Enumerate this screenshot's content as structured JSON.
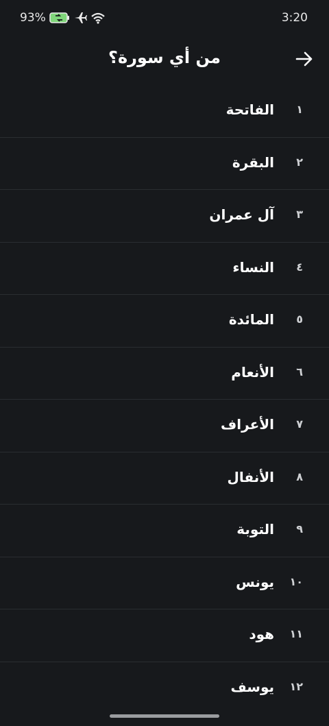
{
  "status_bar": {
    "battery_percent": "93%",
    "time": "3:20",
    "icons": [
      "battery-charging-icon",
      "airplane-icon",
      "wifi-icon"
    ]
  },
  "header": {
    "title": "من أي سورة؟",
    "back_icon": "arrow-right-icon"
  },
  "surahs": [
    {
      "number": "١",
      "name": "الفاتحة"
    },
    {
      "number": "٢",
      "name": "البقرة"
    },
    {
      "number": "٣",
      "name": "آل عمران"
    },
    {
      "number": "٤",
      "name": "النساء"
    },
    {
      "number": "٥",
      "name": "المائدة"
    },
    {
      "number": "٦",
      "name": "الأنعام"
    },
    {
      "number": "٧",
      "name": "الأعراف"
    },
    {
      "number": "٨",
      "name": "الأنفال"
    },
    {
      "number": "٩",
      "name": "التوبة"
    },
    {
      "number": "١٠",
      "name": "يونس"
    },
    {
      "number": "١١",
      "name": "هود"
    },
    {
      "number": "١٢",
      "name": "يوسف"
    }
  ],
  "colors": {
    "background": "#17191c",
    "divider": "#2a2d31",
    "battery_accent": "#7fd67a"
  }
}
